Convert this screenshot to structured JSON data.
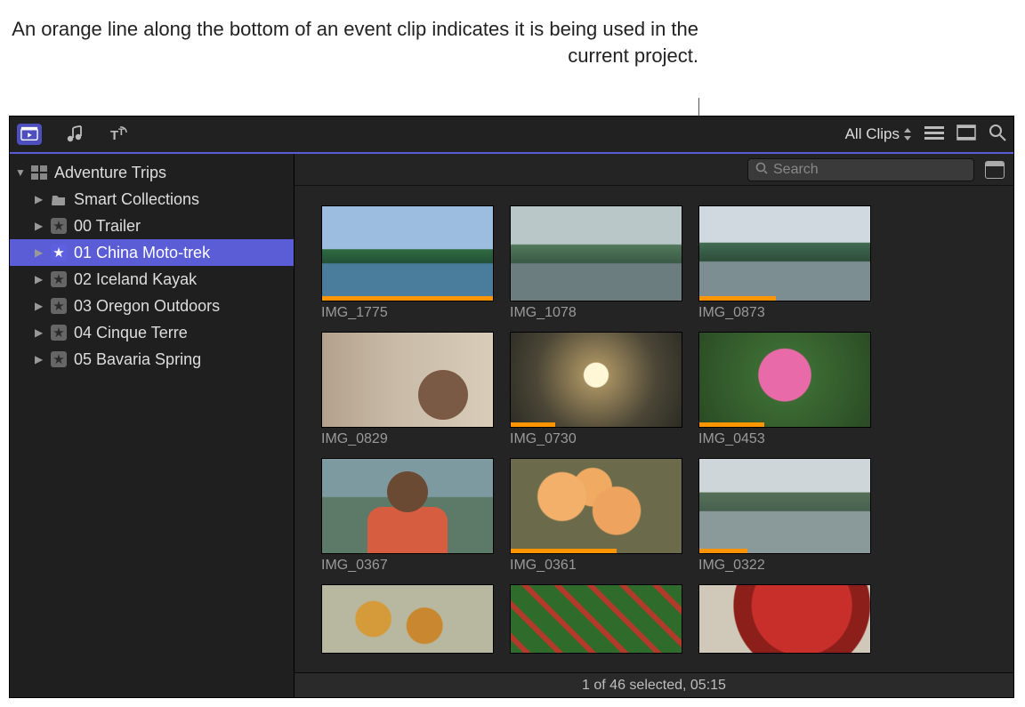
{
  "annotation": "An orange line along the bottom of an event clip indicates it is being used in the current project.",
  "toolbar": {
    "filter_label": "All Clips"
  },
  "search": {
    "placeholder": "Search"
  },
  "library": {
    "name": "Adventure Trips",
    "items": [
      {
        "label": "Smart Collections",
        "icon": "folder"
      },
      {
        "label": "00 Trailer",
        "icon": "star"
      },
      {
        "label": "01 China Moto-trek",
        "icon": "star",
        "selected": true
      },
      {
        "label": "02 Iceland Kayak",
        "icon": "star"
      },
      {
        "label": "03 Oregon Outdoors",
        "icon": "star"
      },
      {
        "label": "04 Cinque Terre",
        "icon": "star"
      },
      {
        "label": "05 Bavaria Spring",
        "icon": "star"
      }
    ]
  },
  "clips": [
    {
      "name": "IMG_1775",
      "used_pct": 100,
      "scene": "scene-mountain"
    },
    {
      "name": "IMG_1078",
      "used_pct": 0,
      "scene": "scene-mountain2"
    },
    {
      "name": "IMG_0873",
      "used_pct": 45,
      "scene": "scene-mountain3"
    },
    {
      "name": "IMG_0829",
      "used_pct": 0,
      "scene": "scene-people"
    },
    {
      "name": "IMG_0730",
      "used_pct": 26,
      "scene": "scene-sunset"
    },
    {
      "name": "IMG_0453",
      "used_pct": 38,
      "scene": "scene-flower"
    },
    {
      "name": "IMG_0367",
      "used_pct": 0,
      "scene": "scene-man"
    },
    {
      "name": "IMG_0361",
      "used_pct": 62,
      "scene": "scene-peach"
    },
    {
      "name": "IMG_0322",
      "used_pct": 28,
      "scene": "scene-river"
    },
    {
      "name": "",
      "used_pct": 0,
      "scene": "scene-veg1",
      "short": true
    },
    {
      "name": "",
      "used_pct": 0,
      "scene": "scene-veg2",
      "short": true
    },
    {
      "name": "",
      "used_pct": 0,
      "scene": "scene-lantern",
      "short": true
    }
  ],
  "status": "1 of 46 selected, 05:15"
}
